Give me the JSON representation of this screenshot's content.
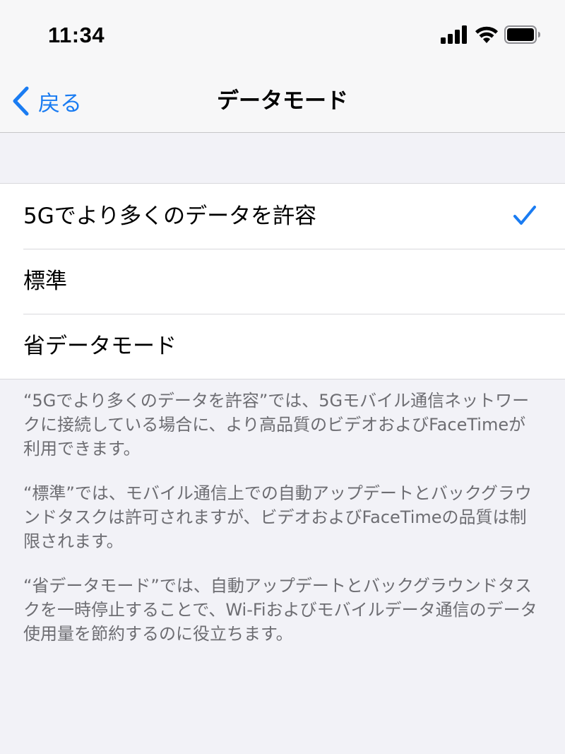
{
  "status_bar": {
    "time": "11:34",
    "icons": [
      "cellular-signal-icon",
      "wifi-icon",
      "battery-icon"
    ]
  },
  "nav": {
    "back_label": "戻る",
    "title": "データモード"
  },
  "options": [
    {
      "label": "5Gでより多くのデータを許容",
      "selected": true
    },
    {
      "label": "標準",
      "selected": false
    },
    {
      "label": "省データモード",
      "selected": false
    }
  ],
  "footer": {
    "descriptions": [
      "“5Gでより多くのデータを許容”では、5Gモバイル通信ネットワークに接続している場合に、より高品質のビデオおよびFaceTimeが利用できます。",
      "“標準”では、モバイル通信上での自動アップデートとバックグラウンドタスクは許可されますが、ビデオおよびFaceTimeの品質は制限されます。",
      "“省データモード”では、自動アップデートとバックグラウンドタスクを一時停止することで、Wi-Fiおよびモバイルデータ通信のデータ使用量を節約するのに役立ちます。"
    ]
  },
  "colors": {
    "accent": "#1a7cf2",
    "background": "#f2f2f7",
    "footer_text": "#6d6d72"
  }
}
